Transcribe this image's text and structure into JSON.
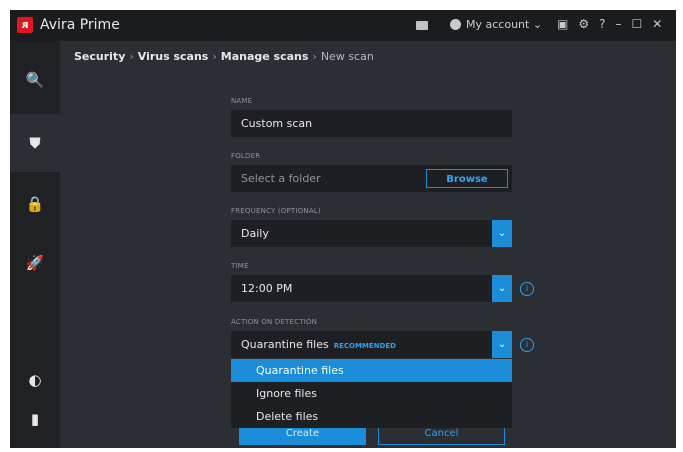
{
  "window": {
    "app_name": "Avira Prime",
    "logo_glyph": "ᴙ",
    "account_label": "My account ⌄",
    "controls": {
      "help": "?",
      "minimize": "–",
      "maximize": "☐",
      "close": "✕"
    }
  },
  "sidebar": {
    "items": [
      {
        "name": "status",
        "icon": "search-shield-icon",
        "glyph": "🔍"
      },
      {
        "name": "security",
        "icon": "shield-check-icon",
        "glyph": "⛊"
      },
      {
        "name": "privacy",
        "icon": "lock-icon",
        "glyph": "🔒"
      },
      {
        "name": "performance",
        "icon": "rocket-icon",
        "glyph": "🚀"
      },
      {
        "name": "profile",
        "icon": "head-profile-icon",
        "glyph": "◐"
      },
      {
        "name": "device",
        "icon": "phone-icon",
        "glyph": "▮"
      }
    ]
  },
  "breadcrumb": {
    "items": [
      "Security",
      "Virus scans",
      "Manage scans"
    ],
    "current": "New scan",
    "separator": "›"
  },
  "form": {
    "name": {
      "label": "NAME",
      "value": "Custom scan"
    },
    "folder": {
      "label": "FOLDER",
      "placeholder": "Select a folder",
      "browse_label": "Browse"
    },
    "frequency": {
      "label": "FREQUENCY (OPTIONAL)",
      "value": "Daily"
    },
    "time": {
      "label": "TIME",
      "value": "12:00 PM"
    },
    "action": {
      "label": "ACTION ON DETECTION",
      "value": "Quarantine files",
      "badge": "RECOMMENDED",
      "options": [
        "Quarantine files",
        "Ignore files",
        "Delete files"
      ],
      "selected_option": "Quarantine files"
    }
  },
  "buttons": {
    "create": "Create",
    "cancel": "Cancel"
  },
  "icons": {
    "dropdown_arrow": "⌄",
    "info": "i"
  },
  "colors": {
    "accent": "#1a8cd8",
    "brand_red": "#e0171f",
    "field_bg": "#1d1f22",
    "sidebar_bg": "#1f2124"
  }
}
